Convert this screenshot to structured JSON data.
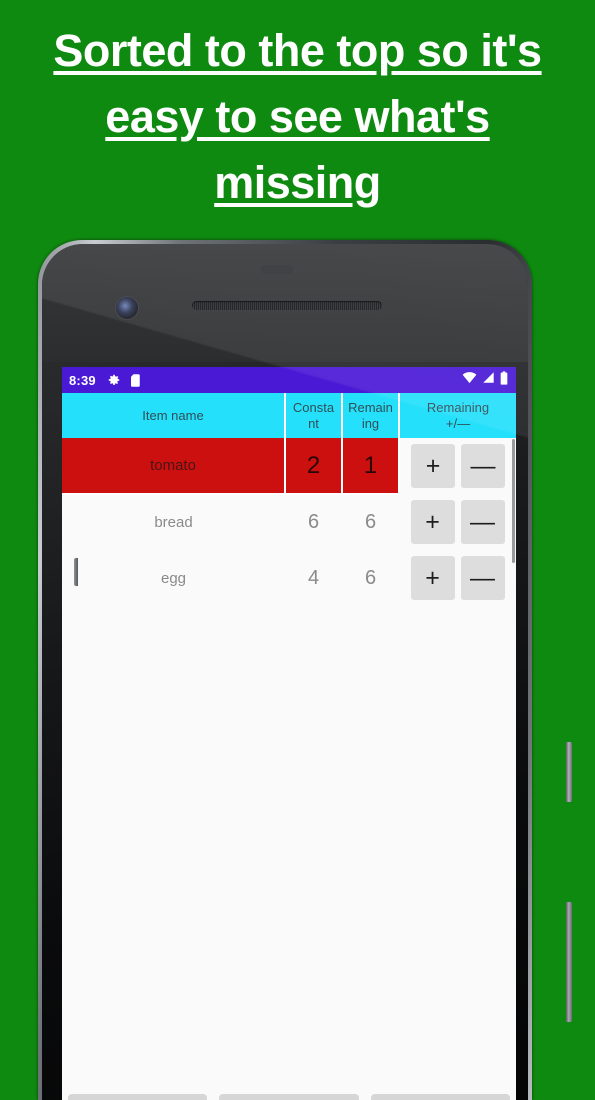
{
  "promo": {
    "lines": [
      "Sorted to the top so it's",
      "easy to see what's",
      "missing"
    ],
    "background_color": "#0f8a10",
    "text_color": "#ffffff"
  },
  "phone": {
    "status_bar": {
      "time": "8:39",
      "left_icons": [
        "gear-icon",
        "sd-card-icon"
      ],
      "right_icons": [
        "wifi-icon",
        "signal-icon",
        "battery-icon"
      ],
      "background_color": "#4a19d6"
    },
    "app": {
      "table": {
        "header_color": "#25e0fb",
        "alert_row_color": "#cc1010",
        "columns": [
          "Item name",
          "Constant",
          "Remaining",
          "Remaining +/−"
        ],
        "columns_wrapped": [
          [
            "Item name"
          ],
          [
            "Consta",
            "nt"
          ],
          [
            "Remain",
            "ing"
          ],
          [
            "Remaining",
            "+/—"
          ]
        ],
        "rows": [
          {
            "name": "tomato",
            "constant": "2",
            "remaining": "1",
            "alert": true,
            "plus": "+",
            "minus": "—"
          },
          {
            "name": "bread",
            "constant": "6",
            "remaining": "6",
            "alert": false,
            "plus": "+",
            "minus": "—"
          },
          {
            "name": "egg",
            "constant": "4",
            "remaining": "6",
            "alert": false,
            "plus": "+",
            "minus": "—"
          }
        ]
      }
    }
  }
}
